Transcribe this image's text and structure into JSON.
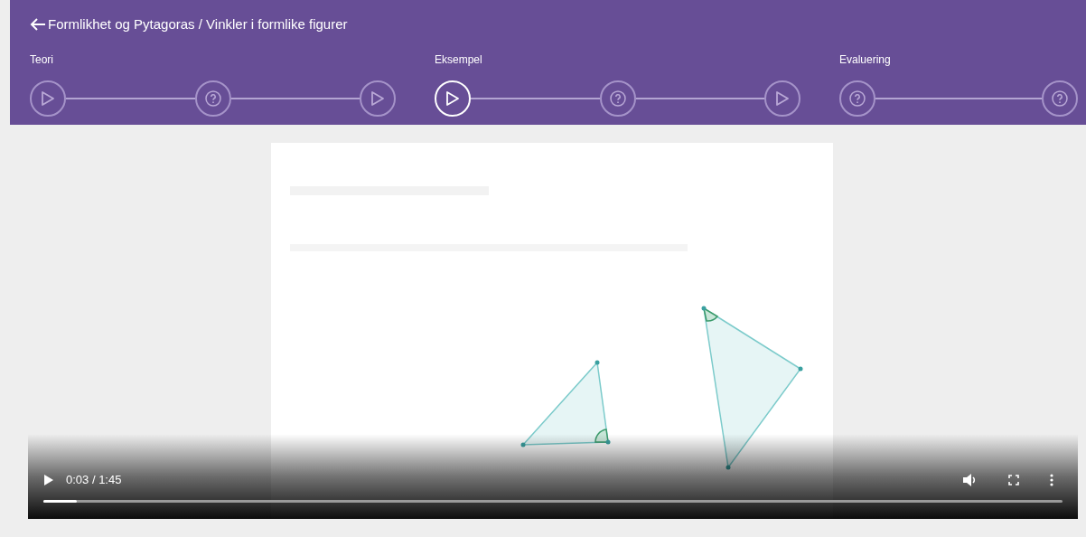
{
  "breadcrumb": "Formlikhet og Pytagoras / Vinkler i formlike figurer",
  "sections": [
    {
      "label": "Teori",
      "items": [
        {
          "kind": "play",
          "selected": false
        },
        {
          "kind": "quiz",
          "selected": false
        },
        {
          "kind": "play",
          "selected": false
        }
      ]
    },
    {
      "label": "Eksempel",
      "items": [
        {
          "kind": "play",
          "selected": true
        },
        {
          "kind": "quiz",
          "selected": false
        },
        {
          "kind": "play",
          "selected": false
        }
      ]
    },
    {
      "label": "Evaluering",
      "items": [
        {
          "kind": "quiz",
          "selected": false
        },
        {
          "kind": "quiz",
          "selected": false
        }
      ]
    }
  ],
  "video": {
    "kind": "picture",
    "time": "0:03 / 1:45",
    "progress": {
      "level": 0.033
    }
  }
}
